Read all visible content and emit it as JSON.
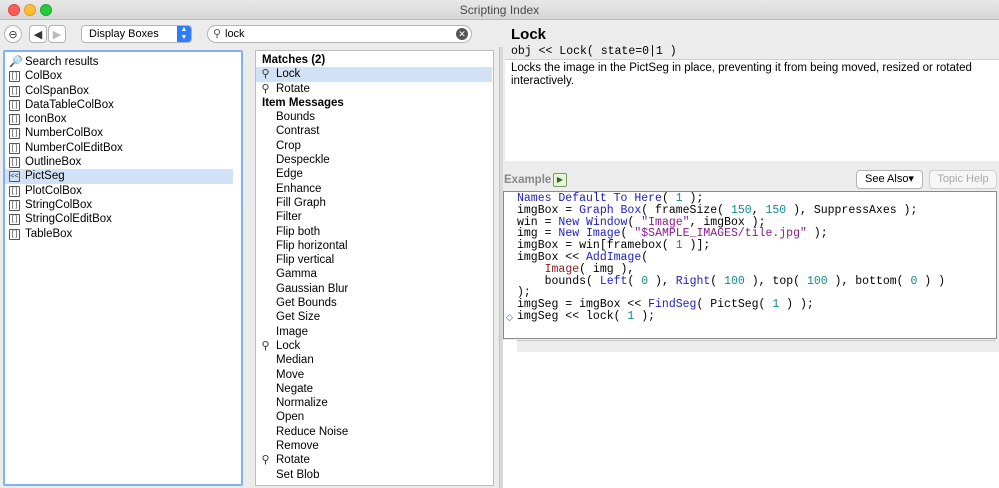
{
  "window": {
    "title": "Scripting Index"
  },
  "toolbar": {
    "collapse_glyph": "⊖",
    "back_glyph": "◀",
    "forward_glyph": "▶",
    "dropdown_value": "Display Boxes",
    "search_value": "lock"
  },
  "left_list": [
    {
      "label": "Search results",
      "icon": "search-icon",
      "glyph": "🔎",
      "selected": false
    },
    {
      "label": "ColBox",
      "icon": "box-icon",
      "glyph": "[ ]",
      "selected": false
    },
    {
      "label": "ColSpanBox",
      "icon": "box-icon",
      "glyph": "[ ]",
      "selected": false
    },
    {
      "label": "DataTableColBox",
      "icon": "box-icon",
      "glyph": "[ ]",
      "selected": false
    },
    {
      "label": "IconBox",
      "icon": "box-icon",
      "glyph": "[ ]",
      "selected": false
    },
    {
      "label": "NumberColBox",
      "icon": "box-icon",
      "glyph": "[ ]",
      "selected": false
    },
    {
      "label": "NumberColEditBox",
      "icon": "box-icon",
      "glyph": "[ ]",
      "selected": false
    },
    {
      "label": "OutlineBox",
      "icon": "box-icon",
      "glyph": "[ ]",
      "selected": false
    },
    {
      "label": "PictSeg",
      "icon": "pictseg-icon",
      "glyph": "<<",
      "selected": true
    },
    {
      "label": "PlotColBox",
      "icon": "box-icon",
      "glyph": "[ ]",
      "selected": false
    },
    {
      "label": "StringColBox",
      "icon": "box-icon",
      "glyph": "[ ]",
      "selected": false
    },
    {
      "label": "StringColEditBox",
      "icon": "box-icon",
      "glyph": "[ ]",
      "selected": false
    },
    {
      "label": "TableBox",
      "icon": "box-icon",
      "glyph": "[ ]",
      "selected": false
    }
  ],
  "middle_list": {
    "matches_header": "Matches (2)",
    "matches": [
      {
        "label": "Lock",
        "selected": true
      },
      {
        "label": "Rotate",
        "selected": false
      }
    ],
    "messages_header": "Item Messages",
    "messages": [
      {
        "label": "Bounds",
        "match": false
      },
      {
        "label": "Contrast",
        "match": false
      },
      {
        "label": "Crop",
        "match": false
      },
      {
        "label": "Despeckle",
        "match": false
      },
      {
        "label": "Edge",
        "match": false
      },
      {
        "label": "Enhance",
        "match": false
      },
      {
        "label": "Fill Graph",
        "match": false
      },
      {
        "label": "Filter",
        "match": false
      },
      {
        "label": "Flip both",
        "match": false
      },
      {
        "label": "Flip horizontal",
        "match": false
      },
      {
        "label": "Flip vertical",
        "match": false
      },
      {
        "label": "Gamma",
        "match": false
      },
      {
        "label": "Gaussian Blur",
        "match": false
      },
      {
        "label": "Get Bounds",
        "match": false
      },
      {
        "label": "Get Size",
        "match": false
      },
      {
        "label": "Image",
        "match": false
      },
      {
        "label": "Lock",
        "match": true
      },
      {
        "label": "Median",
        "match": false
      },
      {
        "label": "Move",
        "match": false
      },
      {
        "label": "Negate",
        "match": false
      },
      {
        "label": "Normalize",
        "match": false
      },
      {
        "label": "Open",
        "match": false
      },
      {
        "label": "Reduce Noise",
        "match": false
      },
      {
        "label": "Remove",
        "match": false
      },
      {
        "label": "Rotate",
        "match": true
      },
      {
        "label": "Set Blob",
        "match": false
      }
    ]
  },
  "topic": {
    "title": "Lock",
    "signature": "obj << Lock( state=0|1 )",
    "description": "Locks the image in the PictSeg in place, preventing it from being moved, resized or rotated interactively."
  },
  "example": {
    "label": "Example",
    "see_also": "See Also▾",
    "topic_help": "Topic Help",
    "code_lines": [
      "Names Default To Here( 1 );",
      "imgBox = Graph Box( frameSize( 150, 150 ), SuppressAxes );",
      "win = New Window( \"Image\", imgBox );",
      "img = New Image( \"$SAMPLE_IMAGES/tile.jpg\" );",
      "imgBox = win[framebox( 1 )];",
      "imgBox << AddImage(",
      "    Image( img ),",
      "    bounds( Left( 0 ), Right( 100 ), top( 100 ), bottom( 0 ) )",
      ");",
      "imgSeg = imgBox << FindSeg( PictSeg( 1 ) );",
      "imgSeg << lock( 1 );"
    ]
  }
}
